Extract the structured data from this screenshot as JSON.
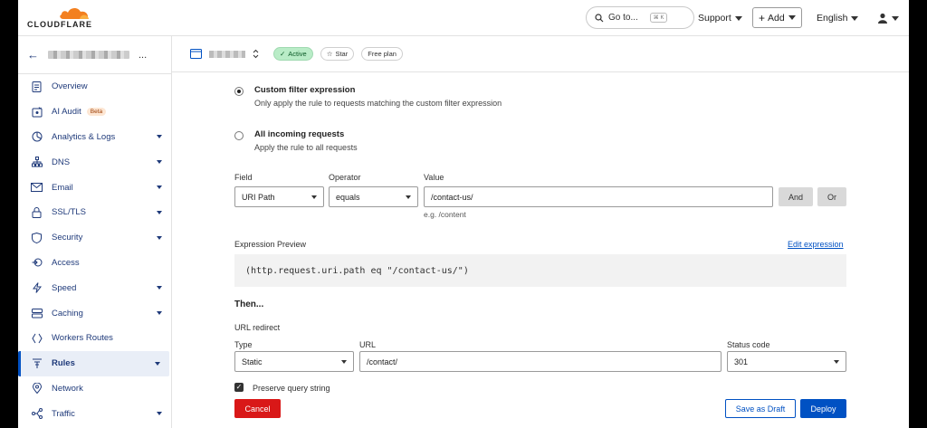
{
  "header": {
    "logo_text": "CLOUDFLARE",
    "goto_label": "Go to...",
    "goto_shortcut": "⌘ K",
    "support_label": "Support",
    "add_label": "Add",
    "language_label": "English"
  },
  "sidebar": {
    "items": [
      {
        "label": "Overview",
        "icon": "document-icon"
      },
      {
        "label": "AI Audit",
        "icon": "ai-audit-icon",
        "badge": "Beta"
      },
      {
        "label": "Analytics & Logs",
        "icon": "clock-chart-icon"
      },
      {
        "label": "DNS",
        "icon": "sitemap-icon"
      },
      {
        "label": "Email",
        "icon": "envelope-icon"
      },
      {
        "label": "SSL/TLS",
        "icon": "lock-icon"
      },
      {
        "label": "Security",
        "icon": "shield-icon"
      },
      {
        "label": "Access",
        "icon": "access-icon"
      },
      {
        "label": "Speed",
        "icon": "bolt-icon"
      },
      {
        "label": "Caching",
        "icon": "server-icon"
      },
      {
        "label": "Workers Routes",
        "icon": "workers-icon"
      },
      {
        "label": "Rules",
        "icon": "rules-icon"
      },
      {
        "label": "Network",
        "icon": "pin-icon"
      },
      {
        "label": "Traffic",
        "icon": "traffic-icon"
      }
    ]
  },
  "zone": {
    "status": "Active",
    "star_label": "Star",
    "plan": "Free plan"
  },
  "filter": {
    "custom": {
      "title": "Custom filter expression",
      "desc": "Only apply the rule to requests matching the custom filter expression"
    },
    "all": {
      "title": "All incoming requests",
      "desc": "Apply the rule to all requests"
    },
    "field_label": "Field",
    "operator_label": "Operator",
    "value_label": "Value",
    "field_value": "URI Path",
    "operator_value": "equals",
    "value_value": "/contact-us/",
    "value_hint": "e.g. /content",
    "and_label": "And",
    "or_label": "Or"
  },
  "expression": {
    "label": "Expression Preview",
    "edit_label": "Edit expression",
    "code": "(http.request.uri.path eq \"/contact-us/\")"
  },
  "then": {
    "title": "Then...",
    "action_label": "URL redirect",
    "type_label": "Type",
    "type_value": "Static",
    "url_label": "URL",
    "url_value": "/contact/",
    "status_label": "Status code",
    "status_value": "301",
    "preserve_label": "Preserve query string"
  },
  "actions": {
    "cancel": "Cancel",
    "draft": "Save as Draft",
    "deploy": "Deploy"
  },
  "colors": {
    "accent": "#0051c3",
    "danger": "#d91818",
    "active_pill": "#b9ecc7",
    "logo_orange": "#f38020"
  }
}
